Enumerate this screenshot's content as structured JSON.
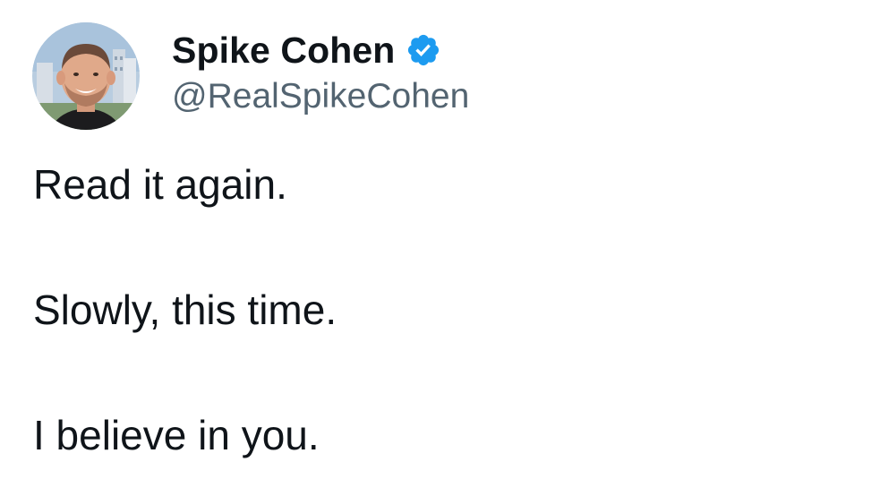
{
  "tweet": {
    "author": {
      "display_name": "Spike Cohen",
      "handle": "@RealSpikeCohen",
      "verified": true,
      "verified_icon": "verified-badge-icon",
      "avatar_icon": "avatar-photo"
    },
    "lines": [
      "Read it again.",
      "Slowly, this time.",
      "I believe in you."
    ]
  },
  "colors": {
    "text_primary": "#0f1419",
    "text_secondary": "#536471",
    "verified_blue": "#1d9bf0",
    "background": "#ffffff"
  }
}
